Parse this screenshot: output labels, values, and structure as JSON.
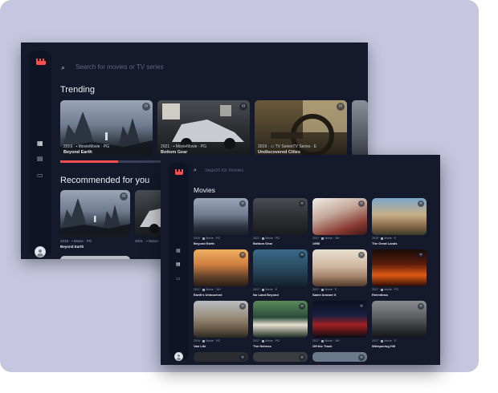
{
  "back_window": {
    "search": {
      "placeholder": "Search for movies or TV series"
    },
    "sections": {
      "trending": "Trending",
      "recommended": "Recommended for you"
    },
    "trending_progress": 0.4,
    "trending": [
      {
        "meta": "2019 · ▪ MovieMovie · PG",
        "title": "Beyond Earth"
      },
      {
        "meta": "2021 · ▪ MovieMovie · PG",
        "title": "Bottom Gear"
      },
      {
        "meta": "2019 · ▭ TV SeriesTV Series · E",
        "title": "Undiscovered Cities"
      }
    ],
    "recommended": [
      {
        "meta": "2019 · ▪ Movie · PG",
        "title": "Beyond Earth"
      },
      {
        "meta": "2021 · ▪ Movie · PG",
        "title": ""
      }
    ]
  },
  "front_window": {
    "search": {
      "placeholder": "Search for movies"
    },
    "section_title": "Movies",
    "movies": [
      {
        "year": "2019",
        "type": "Movie",
        "rating": "PG",
        "title": "Beyond Earth"
      },
      {
        "year": "2021",
        "type": "Movie",
        "rating": "PG",
        "title": "Bottom Gear"
      },
      {
        "year": "2017",
        "type": "Movie",
        "rating": "18+",
        "title": "1998"
      },
      {
        "year": "2019",
        "type": "Movie",
        "rating": "E",
        "title": "The Great Lands"
      },
      {
        "year": "2017",
        "type": "Movie",
        "rating": "18+",
        "title": "Earth's Untouched"
      },
      {
        "year": "2017",
        "type": "Movie",
        "rating": "E",
        "title": "No Land Beyond"
      },
      {
        "year": "2017",
        "type": "Movie",
        "rating": "E",
        "title": "Same Answer II"
      },
      {
        "year": "2017",
        "type": "Movie",
        "rating": "PG",
        "title": "Relentless"
      },
      {
        "year": "2019",
        "type": "Movie",
        "rating": "PG",
        "title": "Van Life"
      },
      {
        "year": "2017",
        "type": "Movie",
        "rating": "PG",
        "title": "The Heiress"
      },
      {
        "year": "2017",
        "type": "Movie",
        "rating": "18+",
        "title": "Off the Track"
      },
      {
        "year": "2017",
        "type": "Movie",
        "rating": "E",
        "title": "Whispering Hill"
      }
    ]
  },
  "colors": {
    "accent": "#fa4d4d",
    "bg": "#141a2c",
    "sidebar": "#0f1424",
    "frame": "#c6c6e0"
  },
  "icons": {
    "logo": "film-logo-icon",
    "home": "grid-icon",
    "movies": "film-icon",
    "tv": "tv-icon",
    "search": "search-icon",
    "bookmark": "bookmark-icon"
  }
}
